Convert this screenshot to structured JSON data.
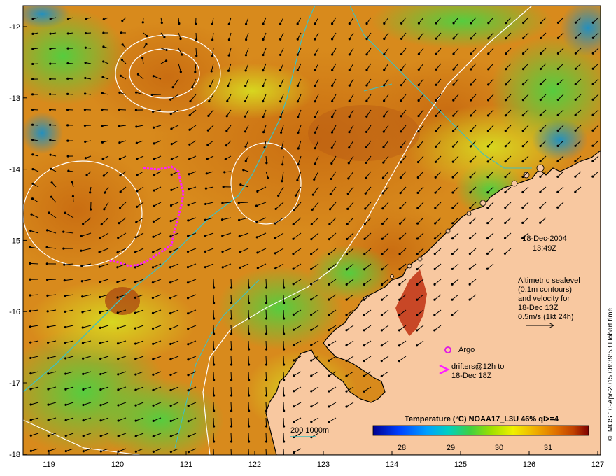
{
  "map": {
    "lon_ticks": [
      "119",
      "120",
      "121",
      "122",
      "123",
      "124",
      "125",
      "126",
      "127"
    ],
    "lat_ticks": [
      "-12",
      "-13",
      "-14",
      "-15",
      "-16",
      "-17",
      "-18"
    ]
  },
  "annotation": {
    "date": "18-Dec-2004",
    "time": "13:49Z",
    "altimetry_lines": [
      "Altimetric sealevel",
      "(0.1m contours)",
      "and velocity for",
      "18-Dec 13Z",
      "0.5m/s (1kt 24h)"
    ]
  },
  "legend": {
    "argo_label": "Argo",
    "drifters_line1": "drifters@12h to",
    "drifters_line2": "18-Dec 18Z",
    "argo_color": "#e020e0",
    "drifter_color": "#ff20ff",
    "isobath_label": "200  1000m",
    "isobath_color": "#40c0c0"
  },
  "colorbar": {
    "title": "Temperature (°C) NOAA17_L3U 46% ql>=4",
    "ticks": [
      "28",
      "29",
      "30",
      "31"
    ]
  },
  "credit": "© IMOS 10-Apr-2015 08:39:53 Hobart time",
  "colors": {
    "land": "#f8c8a0",
    "coast": "#000000"
  }
}
